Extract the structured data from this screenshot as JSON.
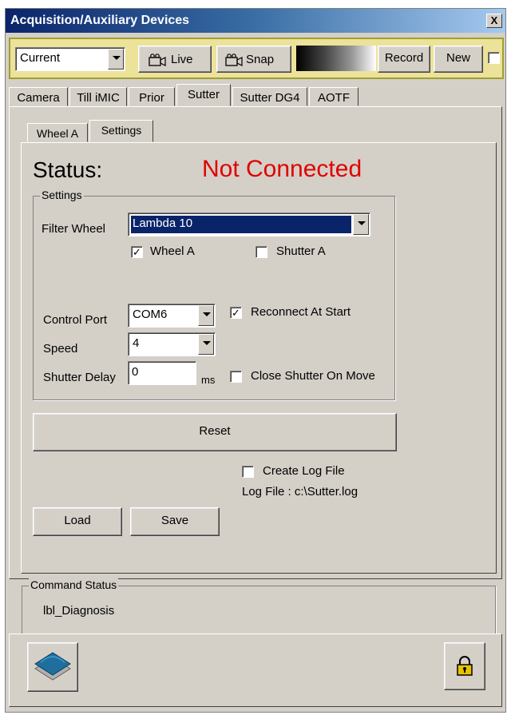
{
  "window": {
    "title": "Acquisition/Auxiliary Devices",
    "close_label": "X"
  },
  "toolbar": {
    "mode_select_value": "Current",
    "live_label": "Live",
    "snap_label": "Snap",
    "record_label": "Record",
    "new_label": "New",
    "new_checked": false
  },
  "device_tabs": {
    "items": [
      {
        "label": "Camera"
      },
      {
        "label": "Till iMIC"
      },
      {
        "label": "Prior"
      },
      {
        "label": "Sutter"
      },
      {
        "label": "Sutter DG4"
      },
      {
        "label": "AOTF"
      }
    ],
    "active": "Sutter"
  },
  "sub_tabs": {
    "items": [
      {
        "label": "Wheel A"
      },
      {
        "label": "Settings"
      }
    ],
    "active": "Settings"
  },
  "status": {
    "label": "Status:",
    "value": "Not Connected",
    "value_color": "#e00000"
  },
  "settings": {
    "group_title": "Settings",
    "filter_wheel_label": "Filter Wheel",
    "filter_wheel_value": "Lambda 10",
    "wheel_a_label": "Wheel A",
    "wheel_a_checked": true,
    "shutter_a_label": "Shutter A",
    "shutter_a_checked": false,
    "control_port_label": "Control Port",
    "control_port_value": "COM6",
    "reconnect_label": "Reconnect At Start",
    "reconnect_checked": true,
    "speed_label": "Speed",
    "speed_value": "4",
    "shutter_delay_label": "Shutter Delay",
    "shutter_delay_value": "0",
    "shutter_delay_unit": "ms",
    "close_shutter_label": "Close Shutter On Move",
    "close_shutter_checked": false
  },
  "actions": {
    "reset_label": "Reset",
    "create_log_label": "Create Log File",
    "create_log_checked": false,
    "log_file_text": "Log File : c:\\Sutter.log",
    "load_label": "Load",
    "save_label": "Save"
  },
  "command_status": {
    "group_title": "Command Status",
    "text": "lbl_Diagnosis"
  },
  "footer": {
    "left_icon": "layers-icon",
    "right_icon": "lock-icon"
  },
  "colors": {
    "title_bar": "#0a246a",
    "toolbar_bg": "#ece29a",
    "window_bg": "#d4d0c8",
    "selection": "#0a246a",
    "status_red": "#e00000"
  }
}
